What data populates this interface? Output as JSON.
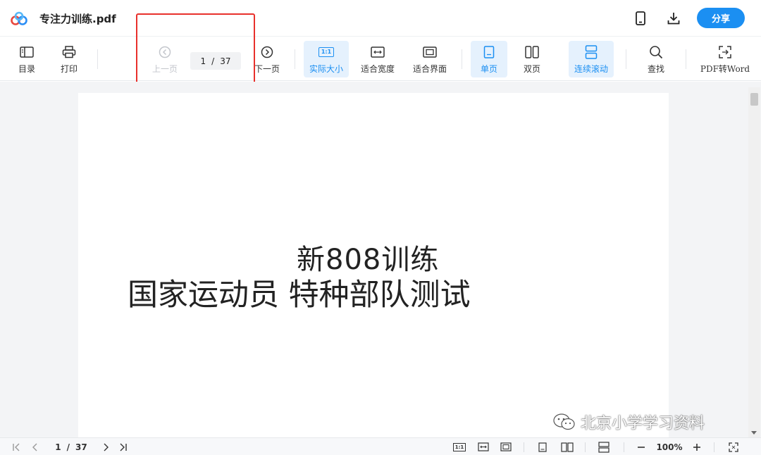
{
  "header": {
    "file_name": "专注力训练.pdf",
    "share_label": "分享",
    "icons": {
      "logo": "cloud-logo-icon",
      "mobile": "phone-icon",
      "download": "download-icon"
    }
  },
  "toolbar": {
    "toc_label": "目录",
    "print_label": "打印",
    "prev_label": "上一页",
    "next_label": "下一页",
    "current_page": "1",
    "page_sep": "/",
    "total_pages": "37",
    "actual_size_label": "实际大小",
    "fit_width_label": "适合宽度",
    "fit_page_label": "适合界面",
    "single_page_label": "单页",
    "double_page_label": "双页",
    "continuous_label": "连续滚动",
    "search_label": "查找",
    "convert_label": "PDF转Word",
    "actual_size_icon_text": "1:1"
  },
  "document": {
    "line1": "新808训练",
    "line2": "国家运动员  特种部队测试"
  },
  "watermark": {
    "text": "北京小学学习资料"
  },
  "statusbar": {
    "current_page": "1",
    "page_sep": "/",
    "total_pages": "37",
    "zoom": "100%",
    "actual_size_icon_text": "1:1"
  },
  "colors": {
    "accent": "#1b8ff2",
    "active_bg": "#e5f1fd",
    "highlight_border": "#e8302c"
  }
}
